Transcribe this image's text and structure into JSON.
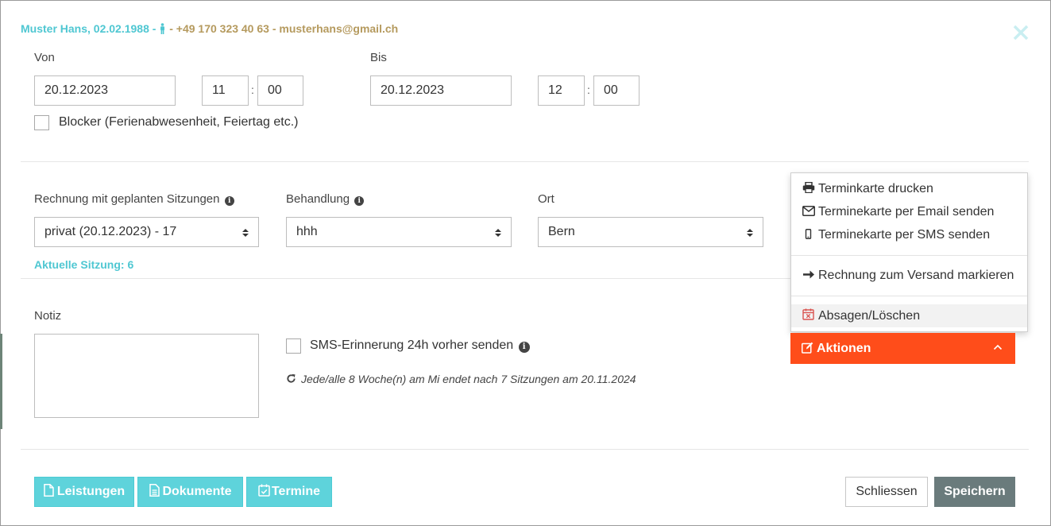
{
  "header": {
    "patient_name_dob": "Muster Hans, 02.02.1988 -",
    "sep": " - ",
    "phone": "+49 170 323 40 63",
    "email": "musterhans@gmail.ch"
  },
  "von": {
    "label": "Von",
    "date": "20.12.2023",
    "hour": "11",
    "minute": "00"
  },
  "bis": {
    "label": "Bis",
    "date": "20.12.2023",
    "hour": "12",
    "minute": "00"
  },
  "time_separator": ":",
  "blocker": {
    "label": "Blocker (Ferienabwesenheit, Feiertag etc.)",
    "checked": false
  },
  "rechnung": {
    "label": "Rechnung mit geplanten Sitzungen",
    "value": "privat (20.12.2023) - 17"
  },
  "behandlung": {
    "label": "Behandlung",
    "value": "hhh"
  },
  "ort": {
    "label": "Ort",
    "value": "Bern"
  },
  "aktuelle_sitzung": "Aktuelle Sitzung: 6",
  "notiz": {
    "label": "Notiz",
    "value": ""
  },
  "sms_reminder": {
    "label": "SMS-Erinnerung 24h vorher senden",
    "checked": false
  },
  "recurrence_text": "Jede/alle 8 Woche(n) am Mi endet nach 7 Sitzungen am 20.11.2024",
  "actions_menu": {
    "items": [
      {
        "label": "Terminkarte drucken",
        "icon": "printer-icon"
      },
      {
        "label": "Terminekarte per Email senden",
        "icon": "envelope-icon"
      },
      {
        "label": "Terminekarte per SMS senden",
        "icon": "mobile-icon"
      },
      {
        "label": "Rechnung zum Versand markieren",
        "icon": "arrow-right-icon"
      },
      {
        "label": "Absagen/Löschen",
        "icon": "calendar-x-icon"
      }
    ],
    "button_label": "Aktionen"
  },
  "footer": {
    "leistungen": "Leistungen",
    "dokumente": "Dokumente",
    "termine": "Termine",
    "schliessen": "Schliessen",
    "speichern": "Speichern"
  },
  "colors": {
    "teal": "#4fc7d2",
    "gold": "#b59a5e",
    "accent_orange": "#ff4d1a",
    "save_gray": "#6a7b7c"
  }
}
